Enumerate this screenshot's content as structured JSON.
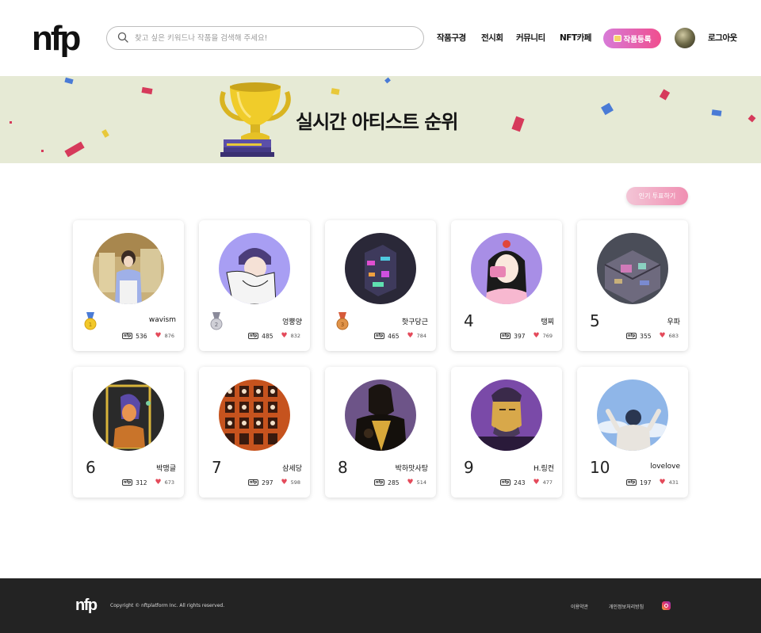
{
  "header": {
    "logo": "nfp",
    "search_placeholder": "찾고 싶은 키워드나 작품을 검색해 주세요!",
    "nav": [
      "작품구경",
      "전시회",
      "커뮤니티",
      "NFT카페"
    ],
    "register_label": "작품등록",
    "logout_label": "로그아웃"
  },
  "banner": {
    "title": "실시간 아티스트 순위"
  },
  "vote_label": "인기 투표하기",
  "artists": [
    {
      "rank": "",
      "medal": "gold",
      "name": "wavism",
      "works": "536",
      "likes": "876"
    },
    {
      "rank": "",
      "medal": "silver",
      "name": "엉뿡양",
      "works": "485",
      "likes": "832"
    },
    {
      "rank": "",
      "medal": "bronze",
      "name": "핫구당근",
      "works": "465",
      "likes": "784"
    },
    {
      "rank": "4",
      "name": "탱찌",
      "works": "397",
      "likes": "769"
    },
    {
      "rank": "5",
      "name": "우파",
      "works": "355",
      "likes": "683"
    },
    {
      "rank": "6",
      "name": "박맹글",
      "works": "312",
      "likes": "673"
    },
    {
      "rank": "7",
      "name": "삼세당",
      "works": "297",
      "likes": "598"
    },
    {
      "rank": "8",
      "name": "박하맛사탕",
      "works": "285",
      "likes": "514"
    },
    {
      "rank": "9",
      "name": "H.링컨",
      "works": "243",
      "likes": "477"
    },
    {
      "rank": "10",
      "name": "lovelove",
      "works": "197",
      "likes": "431"
    }
  ],
  "footer": {
    "logo": "nfp",
    "copyright": "Copyright © nftplatform Inc. All rights reserved.",
    "terms": "이용약관",
    "privacy": "개인정보처리방침"
  },
  "colors": {
    "accent": "#f04e8e",
    "banner_bg": "#e6ead5",
    "footer_bg": "#232323",
    "heart": "#e44a5a"
  }
}
